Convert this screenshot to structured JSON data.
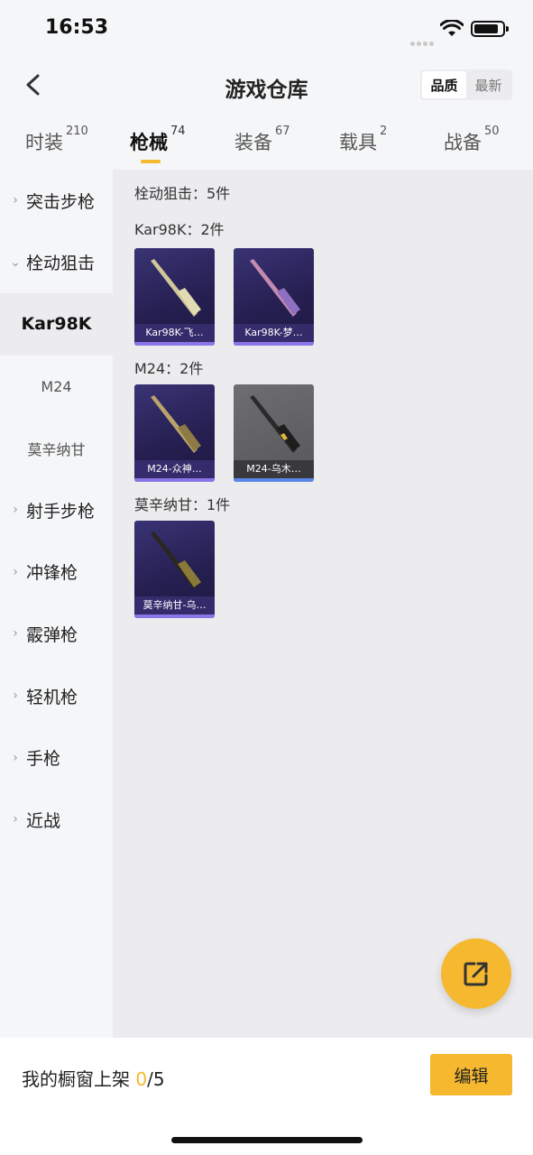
{
  "status_bar": {
    "time": "16:53"
  },
  "header": {
    "title": "游戏仓库",
    "sort_options": [
      "品质",
      "最新"
    ],
    "active_sort": "品质"
  },
  "tabs": [
    {
      "label": "时装",
      "count": "210"
    },
    {
      "label": "枪械",
      "count": "74"
    },
    {
      "label": "装备",
      "count": "67"
    },
    {
      "label": "载具",
      "count": "2"
    },
    {
      "label": "战备",
      "count": "50"
    }
  ],
  "active_tab": "枪械",
  "sidebar": {
    "items": [
      {
        "label": "突击步枪",
        "type": "category",
        "expanded": false
      },
      {
        "label": "栓动狙击",
        "type": "category",
        "expanded": true
      },
      {
        "label": "Kar98K",
        "type": "sub",
        "selected": true
      },
      {
        "label": "M24",
        "type": "sub",
        "selected": false
      },
      {
        "label": "莫辛纳甘",
        "type": "sub",
        "selected": false
      },
      {
        "label": "射手步枪",
        "type": "category",
        "expanded": false
      },
      {
        "label": "冲锋枪",
        "type": "category",
        "expanded": false
      },
      {
        "label": "霰弹枪",
        "type": "category",
        "expanded": false
      },
      {
        "label": "轻机枪",
        "type": "category",
        "expanded": false
      },
      {
        "label": "手枪",
        "type": "category",
        "expanded": false
      },
      {
        "label": "近战",
        "type": "category",
        "expanded": false
      }
    ]
  },
  "content": {
    "section_title": "栓动狙击：5件",
    "groups": [
      {
        "title": "Kar98K：2件",
        "items": [
          {
            "name": "Kar98K-飞…",
            "rarity": "purple",
            "gun_color": "#cfc79a"
          },
          {
            "name": "Kar98K-梦…",
            "rarity": "purple",
            "gun_color": "#c58ab0"
          }
        ]
      },
      {
        "title": "M24：2件",
        "items": [
          {
            "name": "M24-众神…",
            "rarity": "purple",
            "gun_color": "#b9a36a"
          },
          {
            "name": "M24-乌木…",
            "rarity": "blue",
            "gun_color": "#2a2a2a"
          }
        ]
      },
      {
        "title": "莫辛纳甘：1件",
        "items": [
          {
            "name": "莫辛纳甘-乌…",
            "rarity": "purple",
            "gun_color": "#8a7a3a"
          }
        ]
      }
    ]
  },
  "bottom_bar": {
    "shelf_label": "我的橱窗上架",
    "shelf_current": "0",
    "shelf_max": "/5",
    "edit_label": "编辑"
  },
  "colors": {
    "accent": "#f5b82e",
    "purple_rarity": "#8a74e6",
    "blue_rarity": "#5a86e8"
  }
}
